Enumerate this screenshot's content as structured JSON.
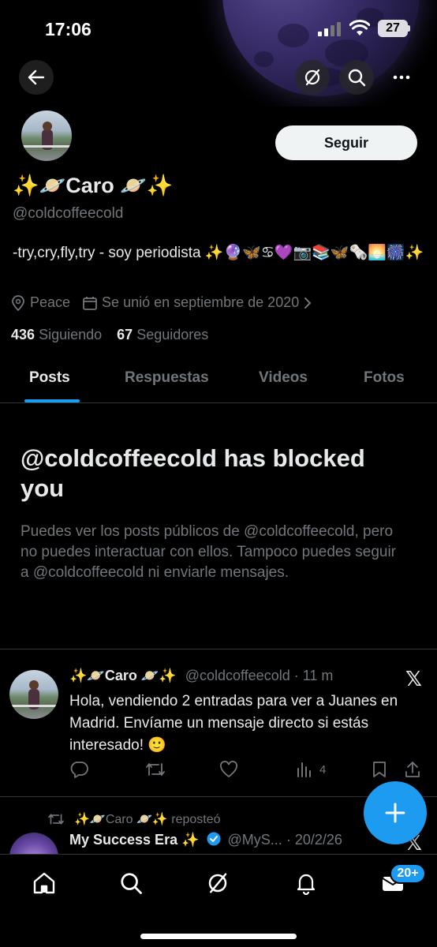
{
  "status_bar": {
    "time": "17:06",
    "battery": "27"
  },
  "profile": {
    "display_name": "✨🪐Caro 🪐✨",
    "handle": "@coldcoffeecold",
    "follow_button": "Seguir",
    "bio": "-try,cry,fly,try - soy periodista ✨🔮🦋♋💜📷📚🦋🗞️🌅🎆✨",
    "location": "Peace",
    "joined": "Se unió en septiembre de 2020",
    "following_count": "436",
    "following_label": "Siguiendo",
    "followers_count": "67",
    "followers_label": "Seguidores"
  },
  "tabs": [
    {
      "label": "Posts",
      "active": true
    },
    {
      "label": "Respuestas",
      "active": false
    },
    {
      "label": "Videos",
      "active": false
    },
    {
      "label": "Fotos",
      "active": false
    }
  ],
  "blocked": {
    "title": "@coldcoffeecold has blocked you",
    "body": "Puedes ver los posts públicos de @coldcoffeecold, pero no puedes interactuar con ellos. Tampoco puedes seguir a @coldcoffeecold ni enviarle mensajes."
  },
  "post1": {
    "author": "✨🪐Caro 🪐✨",
    "handle": "@coldcoffeecold",
    "time": "· 11 m",
    "text": "Hola, vendiendo 2 entradas para ver a Juanes en Madrid. Envíame un mensaje directo si estás interesado! 🙂",
    "views": "4"
  },
  "post2": {
    "repost_by": "✨🪐Caro 🪐✨ reposteó",
    "author": "My Success Era ✨",
    "handle": "@MyS...",
    "time": "· 20/2/26"
  },
  "bottom_nav": {
    "badge": "20+"
  },
  "icons": [
    "back-icon",
    "grok-icon",
    "search-icon",
    "more-icon",
    "location-icon",
    "calendar-icon",
    "chevron-right-icon",
    "reply-icon",
    "repost-icon",
    "like-icon",
    "views-icon",
    "bookmark-icon",
    "share-icon",
    "x-logo-icon",
    "verified-icon",
    "plus-icon",
    "home-icon",
    "communities-icon",
    "notifications-icon",
    "messages-icon"
  ],
  "colors": {
    "accent": "#1d9bf0",
    "text": "#e7e9ea",
    "muted": "#71767b",
    "background": "#000000",
    "divider": "#2f3336"
  }
}
